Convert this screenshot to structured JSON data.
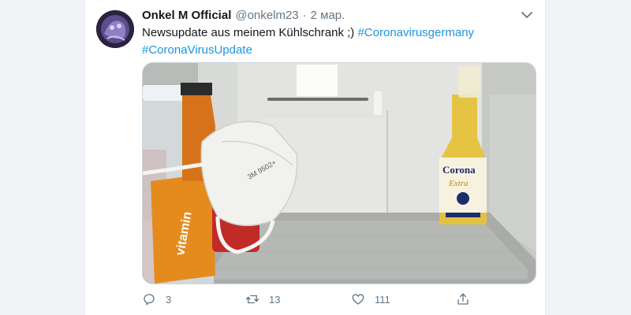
{
  "tweet": {
    "display_name": "Onkel M Official",
    "handle": "@onkelm23",
    "separator": "·",
    "date": "2 мар.",
    "text_line1": "Newsupdate aus meinem Kühlschrank ;) ",
    "hashtag1": "#Coronavirusgermany",
    "hashtag2": "#CoronaVirusUpdate",
    "photo_text": {
      "mask_print": "3M 9502+",
      "beer_brand": "Corona",
      "beer_sub": "Extra",
      "bottle_label": "vitamin"
    }
  },
  "actions": {
    "reply_count": "3",
    "retweet_count": "13",
    "like_count": "111"
  },
  "icons": {
    "reply": "reply-icon",
    "retweet": "retweet-icon",
    "like": "heart-icon",
    "share": "share-icon",
    "caret": "chevron-down-icon"
  },
  "colors": {
    "link": "#1b95e0",
    "muted": "#657786",
    "text": "#14171a"
  }
}
